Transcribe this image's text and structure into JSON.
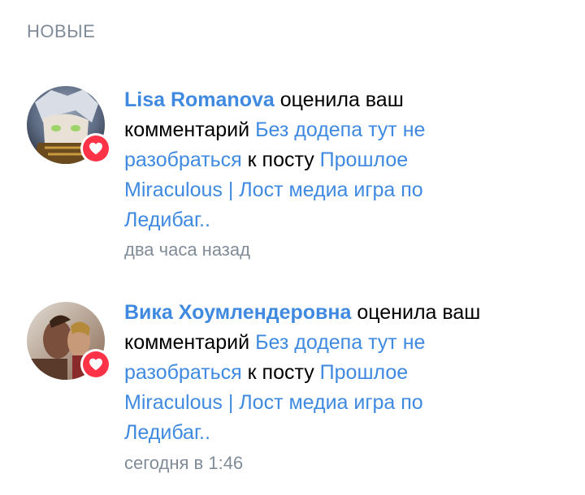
{
  "section": {
    "title": "НОВЫЕ"
  },
  "notifications": [
    {
      "author": "Lisa Romanova",
      "action_1": "оценила ваш комментарий",
      "comment": "Без додепа тут не разобраться",
      "action_2": "к посту",
      "post": "Прошлое Miraculous | Лост медиа игра по Ледибаг..",
      "time": "два часа назад",
      "badge_icon": "heart-icon"
    },
    {
      "author": "Вика Хоумлендеровна",
      "action_1": "оценила ваш комментарий",
      "comment": "Без додепа тут не разобраться",
      "action_2": "к посту",
      "post": "Прошлое Miraculous | Лост медиа игра по Ледибаг..",
      "time": "сегодня в 1:46",
      "badge_icon": "heart-icon"
    }
  ],
  "colors": {
    "link": "#3f8ae0",
    "author": "#2a5885",
    "meta": "#818c99",
    "badge": "#ff3347"
  }
}
